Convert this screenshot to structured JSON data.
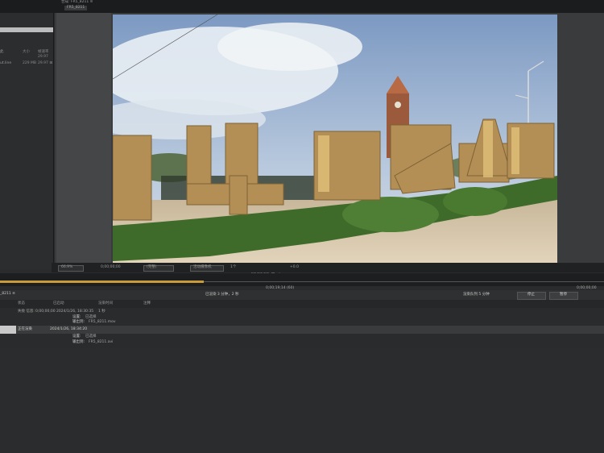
{
  "top_tabs": {
    "composition_tab": "合成: FR5_8211 ≡",
    "sub_tab": "FR5_8211"
  },
  "project_panel": {
    "col_size": "大小",
    "col_rate": "帧速率",
    "row1_name": "此",
    "row2_name": "",
    "row3_name": "ut.line",
    "size_value": "229 MB",
    "rate_value_1": "29.97",
    "rate_value_2": "29.97 ⊞"
  },
  "viewer_toolbar": {
    "zoom": "66.9%",
    "timecode": "0;00;00;00",
    "quality": "(完整)",
    "view": "活动摄像机",
    "views_count": "1个",
    "exposure": "+0.0"
  },
  "timeline": {
    "timecode": "0;00;19;14 (60)",
    "right_timecode": "0;00;00;00",
    "comp_name": "_8211 ≡",
    "center_label": "已渲染 3 分钟，2 秒",
    "render_label": "渲染队列 5 分钟",
    "button_1": "停止",
    "button_2": "暂停"
  },
  "columns": {
    "status": "状态",
    "started": "已启动",
    "render_time": "渲染时间",
    "comment": "注释"
  },
  "rows": [
    {
      "name": "失败 信息:",
      "started": "0;00;00;00 2024/1/26, 18:30:35",
      "render_time": "1 秒",
      "setting_label": "设置:",
      "setting_value": "已选择",
      "output_label": "输出到:",
      "output_value": "FR5_8211.mov"
    },
    {
      "name": "正在渲染",
      "started": "2024/1/26, 18:34:20",
      "setting_label": "设置:",
      "setting_value": "已选择",
      "output_label": "输出到:",
      "output_value": "FR5_8211.avi"
    }
  ]
}
